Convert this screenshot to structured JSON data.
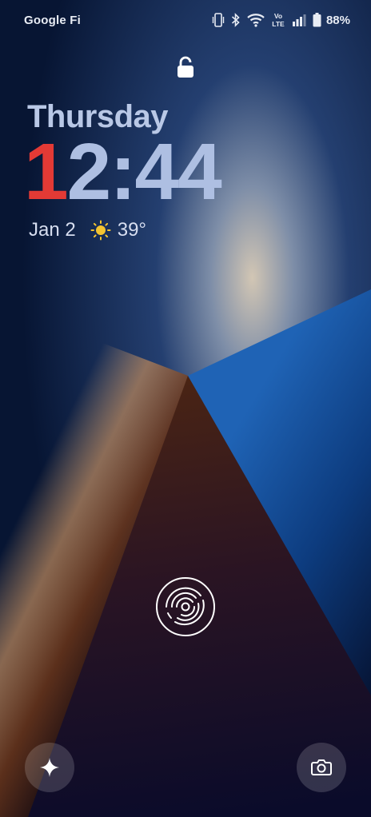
{
  "status_bar": {
    "carrier": "Google Fi",
    "volte": "Vo LTE",
    "battery_percent": "88%",
    "icons": [
      "vibrate-icon",
      "bluetooth-icon",
      "wifi-icon",
      "volte-icon",
      "signal-icon",
      "battery-icon"
    ]
  },
  "lock_screen": {
    "day": "Thursday",
    "time_first_digit": "1",
    "time_rest": "2:44",
    "date": "Jan 2",
    "temperature": "39°",
    "weather_icon": "sun-icon",
    "unlock_icon": "fingerprint-icon"
  },
  "shortcuts": {
    "left_icon": "sparkle-icon",
    "right_icon": "camera-icon"
  },
  "colors": {
    "first_digit": "#e33a35",
    "time": "#aebfe2",
    "day": "#b9c8e6",
    "sun": "#f4c430"
  }
}
